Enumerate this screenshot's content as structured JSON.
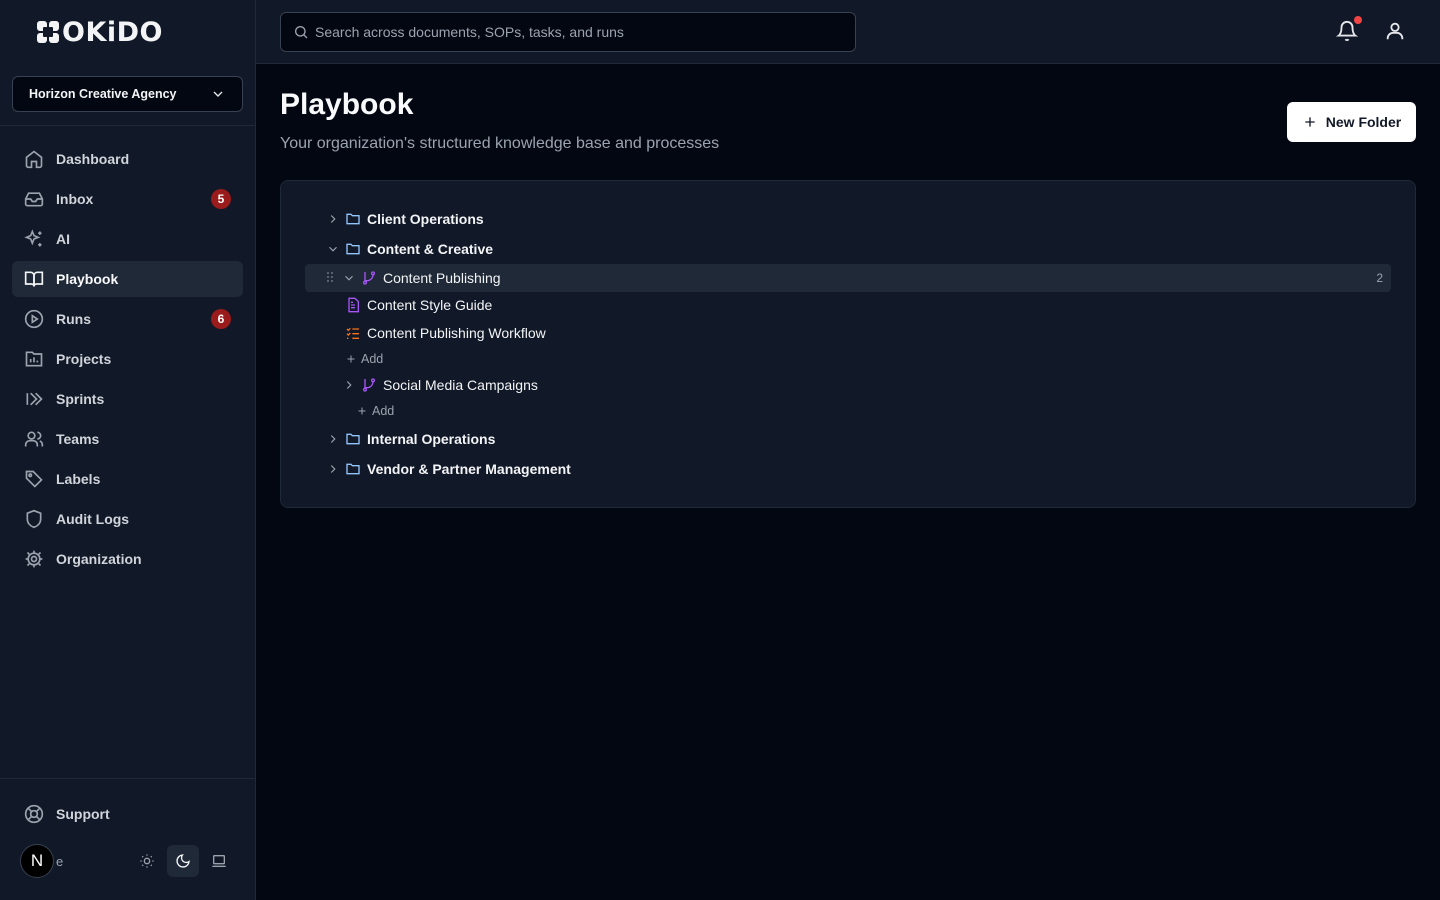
{
  "app": {
    "logo_text": "OKiDO"
  },
  "org": {
    "name": "Horizon Creative Agency"
  },
  "nav": {
    "items": [
      {
        "label": "Dashboard",
        "icon": "home-icon"
      },
      {
        "label": "Inbox",
        "icon": "inbox-icon",
        "badge": "5"
      },
      {
        "label": "AI",
        "icon": "sparkles-icon"
      },
      {
        "label": "Playbook",
        "icon": "book-icon",
        "active": true
      },
      {
        "label": "Runs",
        "icon": "play-circle-icon",
        "badge": "6"
      },
      {
        "label": "Projects",
        "icon": "projects-icon"
      },
      {
        "label": "Sprints",
        "icon": "sprints-icon"
      },
      {
        "label": "Teams",
        "icon": "users-icon"
      },
      {
        "label": "Labels",
        "icon": "tag-icon"
      },
      {
        "label": "Audit Logs",
        "icon": "shield-icon"
      },
      {
        "label": "Organization",
        "icon": "gear-icon"
      }
    ],
    "support_label": "Support"
  },
  "user": {
    "avatar_letter": "N",
    "name_fragment": "e"
  },
  "search": {
    "placeholder": "Search across documents, SOPs, tasks, and runs"
  },
  "page": {
    "title": "Playbook",
    "subtitle": "Your organization's structured knowledge base and processes",
    "new_folder_label": "New Folder"
  },
  "tree": {
    "client_operations": "Client Operations",
    "content_creative": "Content & Creative",
    "content_publishing": "Content Publishing",
    "content_publishing_count": "2",
    "content_style_guide": "Content Style Guide",
    "content_publishing_workflow": "Content Publishing Workflow",
    "add_label": "Add",
    "social_media_campaigns": "Social Media Campaigns",
    "internal_operations": "Internal Operations",
    "vendor_partner": "Vendor & Partner Management"
  },
  "colors": {
    "accent_purple": "#a855f7",
    "accent_orange": "#f97316",
    "folder_blue": "#93c5fd",
    "badge_red": "#991b1b"
  }
}
